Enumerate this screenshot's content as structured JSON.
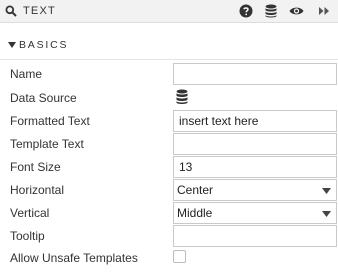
{
  "header": {
    "title": "TEXT",
    "title_icon": "search-icon",
    "buttons": [
      "help-icon",
      "database-icon",
      "eye-icon",
      "fast-forward-icon"
    ]
  },
  "section": {
    "label": "BASICS",
    "icon": "caret-down-icon",
    "expanded": true
  },
  "form": {
    "name": {
      "label": "Name",
      "value": ""
    },
    "data_source": {
      "label": "Data Source",
      "icon": "database-icon"
    },
    "formatted_text": {
      "label": "Formatted Text",
      "value": "insert text here"
    },
    "template_text": {
      "label": "Template Text",
      "value": ""
    },
    "font_size": {
      "label": "Font Size",
      "value": "13"
    },
    "horizontal": {
      "label": "Horizontal",
      "selected": "Center"
    },
    "vertical": {
      "label": "Vertical",
      "selected": "Middle"
    },
    "tooltip": {
      "label": "Tooltip",
      "value": ""
    },
    "allow_unsafe": {
      "label": "Allow Unsafe Templates",
      "checked": false
    }
  }
}
